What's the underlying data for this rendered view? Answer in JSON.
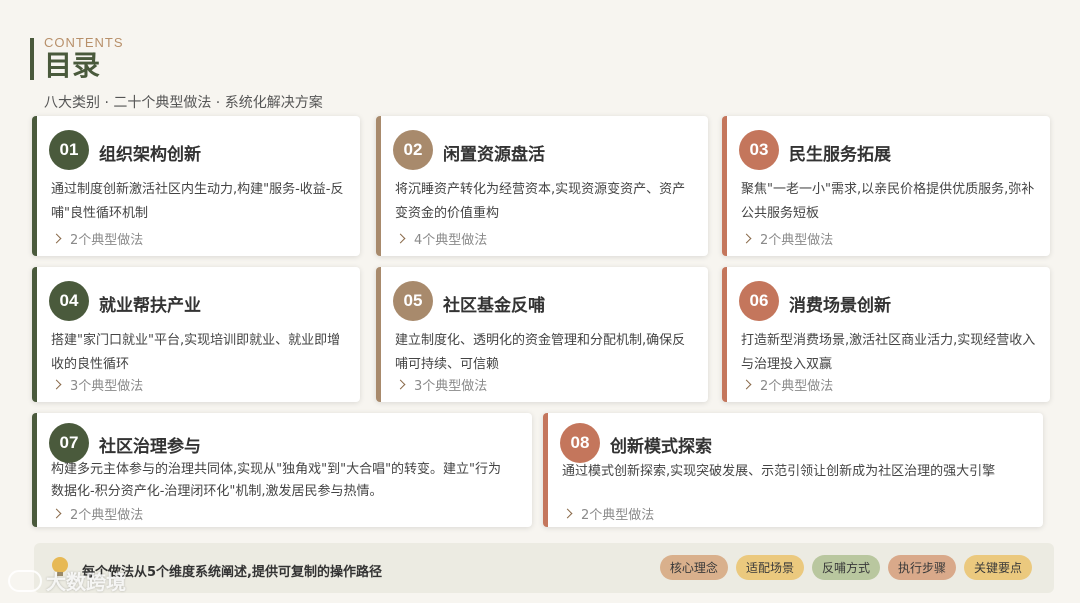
{
  "header": {
    "label": "CONTENTS",
    "title": "目录",
    "subtitle": "八大类别 · 二十个典型做法 · 系统化解决方案"
  },
  "cards": [
    {
      "num": "01",
      "title": "组织架构创新",
      "desc": "通过制度创新激活社区内生动力,构建\"服务-收益-反哺\"良性循环机制",
      "link": "2个典型做法",
      "color": "#4a5a3c"
    },
    {
      "num": "02",
      "title": "闲置资源盘活",
      "desc": "将沉睡资产转化为经营资本,实现资源变资产、资产变资金的价值重构",
      "link": "4个典型做法",
      "color": "#a88a6c"
    },
    {
      "num": "03",
      "title": "民生服务拓展",
      "desc": "聚焦\"一老一小\"需求,以亲民价格提供优质服务,弥补公共服务短板",
      "link": "2个典型做法",
      "color": "#c4765c"
    },
    {
      "num": "04",
      "title": "就业帮扶产业",
      "desc": "搭建\"家门口就业\"平台,实现培训即就业、就业即增收的良性循环",
      "link": "3个典型做法",
      "color": "#4a5a3c"
    },
    {
      "num": "05",
      "title": "社区基金反哺",
      "desc": "建立制度化、透明化的资金管理和分配机制,确保反哺可持续、可信赖",
      "link": "3个典型做法",
      "color": "#a88a6c"
    },
    {
      "num": "06",
      "title": "消费场景创新",
      "desc": "打造新型消费场景,激活社区商业活力,实现经营收入与治理投入双赢",
      "link": "2个典型做法",
      "color": "#c4765c"
    },
    {
      "num": "07",
      "title": "社区治理参与",
      "desc": "构建多元主体参与的治理共同体,实现从\"独角戏\"到\"大合唱\"的转变。建立\"行为数据化-积分资产化-治理闭环化\"机制,激发居民参与热情。",
      "link": "2个典型做法",
      "color": "#4a5a3c"
    },
    {
      "num": "08",
      "title": "创新模式探索",
      "desc": "通过模式创新探索,实现突破发展、示范引领让创新成为社区治理的强大引擎",
      "link": "2个典型做法",
      "color": "#c4765c"
    }
  ],
  "footer": {
    "text": "每个做法从5个维度系统阐述,提供可复制的操作路径",
    "tags": [
      {
        "label": "核心理念",
        "color": "#d9b08c"
      },
      {
        "label": "适配场景",
        "color": "#ebc97e"
      },
      {
        "label": "反哺方式",
        "color": "#b9c79f"
      },
      {
        "label": "执行步骤",
        "color": "#d9a98a"
      },
      {
        "label": "关键要点",
        "color": "#ebc97e"
      }
    ]
  },
  "watermark": "大数跨境"
}
